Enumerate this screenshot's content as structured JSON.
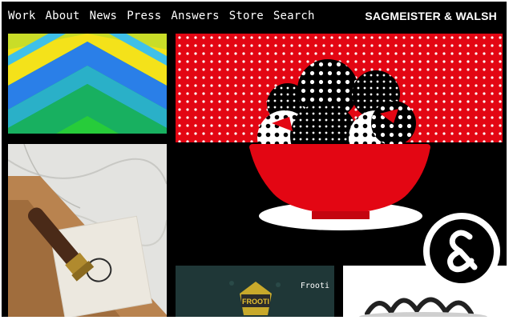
{
  "nav": {
    "items": [
      {
        "label": "Work"
      },
      {
        "label": "About"
      },
      {
        "label": "News"
      },
      {
        "label": "Press"
      },
      {
        "label": "Answers"
      },
      {
        "label": "Store"
      },
      {
        "label": "Search"
      }
    ]
  },
  "brand": {
    "name": "SAGMEISTER & WALSH"
  },
  "tiles": {
    "frooti": {
      "label": "Frooti",
      "sign_text": "FROOTI"
    }
  },
  "colors": {
    "background": "#000000",
    "nav_text": "#ffffff",
    "accent_red": "#e30613"
  }
}
